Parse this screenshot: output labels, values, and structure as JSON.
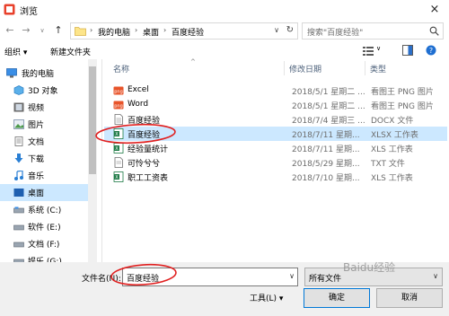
{
  "window": {
    "title": "浏览",
    "close_symbol": "×"
  },
  "nav": {
    "back": "←",
    "forward": "→",
    "up_dropdown": "∨",
    "up": "↑",
    "breadcrumb": [
      "我的电脑",
      "桌面",
      "百度经验"
    ],
    "separator": "›",
    "dropdown_symbol": "∨",
    "refresh_symbol": "↻",
    "search_placeholder": "搜索\"百度经验\""
  },
  "toolbar": {
    "organize": "组织 ▾",
    "new_folder": "新建文件夹"
  },
  "sidebar": {
    "items": [
      {
        "label": "我的电脑",
        "icon": "computer-icon"
      },
      {
        "label": "3D 对象",
        "icon": "cube-3d-icon"
      },
      {
        "label": "视频",
        "icon": "video-icon"
      },
      {
        "label": "图片",
        "icon": "picture-icon"
      },
      {
        "label": "文档",
        "icon": "document-icon"
      },
      {
        "label": "下载",
        "icon": "download-icon"
      },
      {
        "label": "音乐",
        "icon": "music-icon"
      },
      {
        "label": "桌面",
        "icon": "desktop-icon",
        "selected": true
      },
      {
        "label": "系统 (C:)",
        "icon": "drive-icon"
      },
      {
        "label": "软件 (E:)",
        "icon": "drive-icon"
      },
      {
        "label": "文档 (F:)",
        "icon": "drive-icon"
      },
      {
        "label": "娱乐 (G:)",
        "icon": "drive-icon"
      }
    ]
  },
  "columns": {
    "name": "名称",
    "date": "修改日期",
    "type": "类型"
  },
  "files": [
    {
      "name": "Excel",
      "date": "2018/5/1 星期二 ...",
      "type": "看图王 PNG 图片",
      "icon": "png-image-icon"
    },
    {
      "name": "Word",
      "date": "2018/5/1 星期二 ...",
      "type": "看图王 PNG 图片",
      "icon": "png-image-icon"
    },
    {
      "name": "百度经验",
      "date": "2018/7/4 星期三 ...",
      "type": "DOCX 文件",
      "icon": "docx-file-icon"
    },
    {
      "name": "百度经验",
      "date": "2018/7/11 星期...",
      "type": "XLSX 工作表",
      "icon": "xlsx-file-icon",
      "selected": true
    },
    {
      "name": "经验量统计",
      "date": "2018/7/11 星期...",
      "type": "XLS 工作表",
      "icon": "xls-file-icon"
    },
    {
      "name": "可怜兮兮",
      "date": "2018/5/29 星期...",
      "type": "TXT 文件",
      "icon": "txt-file-icon"
    },
    {
      "name": "职工工资表",
      "date": "2018/7/10 星期...",
      "type": "XLS 工作表",
      "icon": "xls-file-icon"
    }
  ],
  "bottom": {
    "filename_label": "文件名(N):",
    "filename_value": "百度经验",
    "filter_value": "所有文件",
    "tools_label": "工具(L)  ▾",
    "open_label": "确定",
    "cancel_label": "取消"
  },
  "watermark": "Baidu经验",
  "colors": {
    "selection": "#cce8ff",
    "annotation": "#e02020",
    "accent": "#0078d7"
  }
}
